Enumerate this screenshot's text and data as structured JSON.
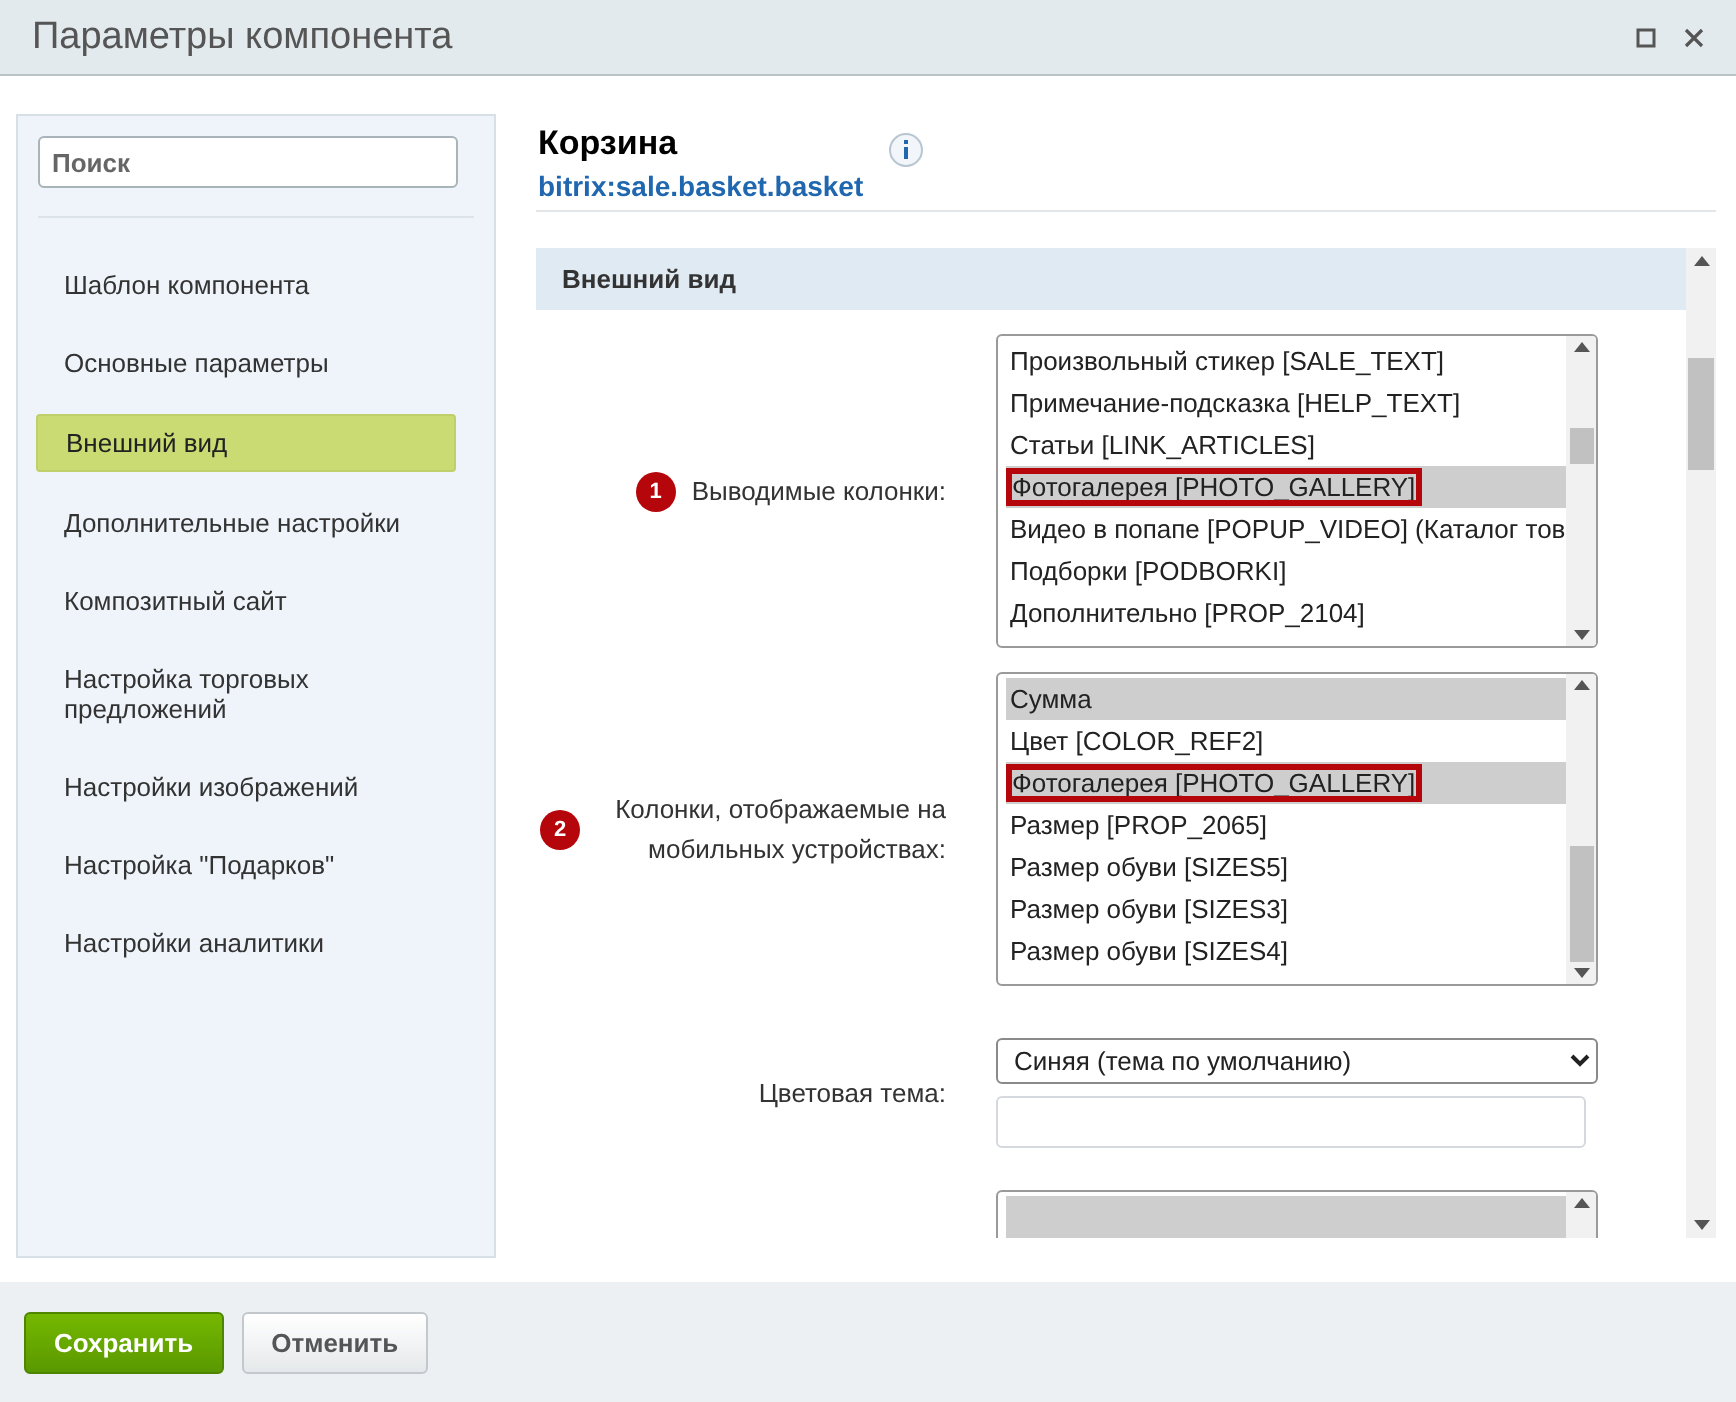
{
  "window": {
    "title": "Параметры компонента"
  },
  "sidebar": {
    "search": {
      "placeholder": "Поиск"
    },
    "items": [
      {
        "label": "Шаблон компонента",
        "selected": false
      },
      {
        "label": "Основные параметры",
        "selected": false
      },
      {
        "label": "Внешний вид",
        "selected": true
      },
      {
        "label": "Дополнительные настройки",
        "selected": false
      },
      {
        "label": "Композитный сайт",
        "selected": false
      },
      {
        "label": "Настройка торговых предложений",
        "selected": false
      },
      {
        "label": "Настройки изображений",
        "selected": false
      },
      {
        "label": "Настройка \"Подарков\"",
        "selected": false
      },
      {
        "label": "Настройки аналитики",
        "selected": false
      }
    ]
  },
  "component": {
    "name": "Корзина",
    "code": "bitrix:sale.basket.basket"
  },
  "section": {
    "title": "Внешний вид"
  },
  "fields": [
    {
      "kind": "multiselect",
      "badge": "1",
      "label": "Выводимые колонки:",
      "options": [
        {
          "label": "Произвольный стикер [SALE_TEXT]",
          "selected": false,
          "highlighted": false
        },
        {
          "label": "Примечание-подсказка [HELP_TEXT]",
          "selected": false,
          "highlighted": false
        },
        {
          "label": "Статьи [LINK_ARTICLES]",
          "selected": false,
          "highlighted": false
        },
        {
          "label": "Фотогалерея [PHOTO_GALLERY]",
          "selected": true,
          "highlighted": true
        },
        {
          "label": "Видео в попапе [POPUP_VIDEO] (Каталог тов",
          "selected": false,
          "highlighted": false
        },
        {
          "label": "Подборки [PODBORKI]",
          "selected": false,
          "highlighted": false
        },
        {
          "label": "Дополнительно [PROP_2104]",
          "selected": false,
          "highlighted": false
        }
      ]
    },
    {
      "kind": "multiselect",
      "badge": "2",
      "label": "Колонки, отображаемые на мобильных устройствах:",
      "options": [
        {
          "label": "Сумма",
          "selected": true,
          "highlighted": false
        },
        {
          "label": "Цвет [COLOR_REF2]",
          "selected": false,
          "highlighted": false
        },
        {
          "label": "Фотогалерея [PHOTO_GALLERY]",
          "selected": true,
          "highlighted": true
        },
        {
          "label": "Размер [PROP_2065]",
          "selected": false,
          "highlighted": false
        },
        {
          "label": "Размер обуви [SIZES5]",
          "selected": false,
          "highlighted": false
        },
        {
          "label": "Размер обуви [SIZES3]",
          "selected": false,
          "highlighted": false
        },
        {
          "label": "Размер обуви [SIZES4]",
          "selected": false,
          "highlighted": false
        }
      ]
    },
    {
      "kind": "select",
      "label": "Цветовая тема:",
      "value": "Синяя (тема по умолчанию)"
    },
    {
      "kind": "partial-multiselect"
    }
  ],
  "buttons": [
    {
      "label": "Сохранить",
      "kind": "primary"
    },
    {
      "label": "Отменить",
      "kind": "secondary"
    }
  ]
}
